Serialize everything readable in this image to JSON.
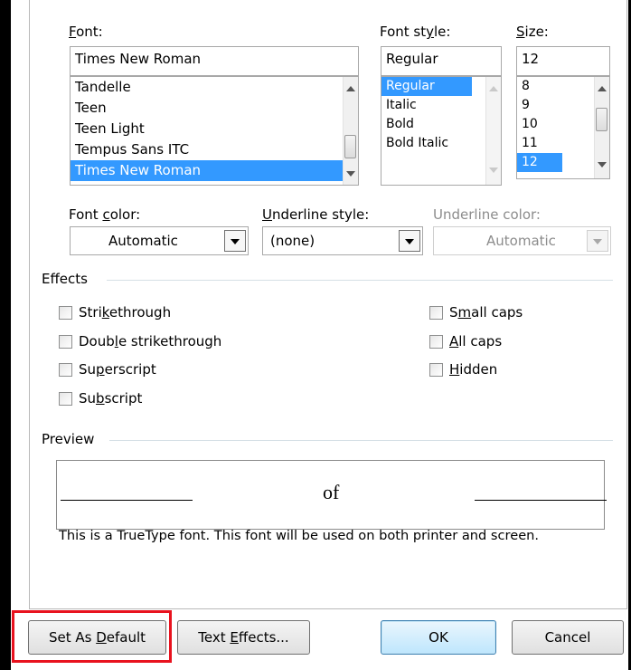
{
  "font": {
    "label": "Font:",
    "value": "Times New Roman",
    "items": [
      "Tandelle",
      "Teen",
      "Teen Light",
      "Tempus Sans ITC",
      "Times New Roman"
    ],
    "selected_index": 4
  },
  "font_style": {
    "label": "Font style:",
    "value": "Regular",
    "items": [
      "Regular",
      "Italic",
      "Bold",
      "Bold Italic"
    ],
    "selected_index": 0
  },
  "size": {
    "label": "Size:",
    "value": "12",
    "items": [
      "8",
      "9",
      "10",
      "11",
      "12"
    ],
    "selected_index": 4
  },
  "font_color": {
    "label": "Font color:",
    "value": "Automatic"
  },
  "underline_style": {
    "label": "Underline style:",
    "value": "(none)"
  },
  "underline_color": {
    "label": "Underline color:",
    "value": "Automatic",
    "disabled": true
  },
  "effects": {
    "title": "Effects",
    "left": [
      "Strikethrough",
      "Double strikethrough",
      "Superscript",
      "Subscript"
    ],
    "right": [
      "Small caps",
      "All caps",
      "Hidden"
    ]
  },
  "preview": {
    "title": "Preview",
    "sample_text": "of",
    "note": "This is a TrueType font. This font will be used on both printer and screen."
  },
  "buttons": {
    "set_as_default": "Set As Default",
    "text_effects": "Text Effects...",
    "ok": "OK",
    "cancel": "Cancel"
  },
  "colors": {
    "selection": "#3399ff",
    "highlight_box": "#e8121e",
    "default_button_border": "#3c7fb1"
  },
  "icons": {
    "scroll_up": "chevron-up-icon",
    "scroll_down": "chevron-down-icon",
    "dropdown": "dropdown-arrow-icon"
  }
}
